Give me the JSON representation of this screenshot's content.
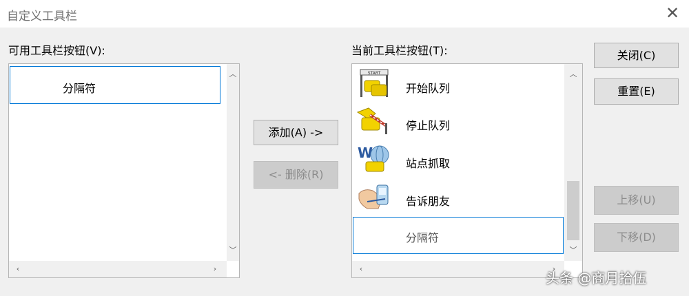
{
  "window": {
    "title": "自定义工具栏",
    "close_glyph": "✕"
  },
  "available": {
    "label": "可用工具栏按钮(V):",
    "items": [
      {
        "label": "分隔符",
        "selected": true
      }
    ]
  },
  "current": {
    "label": "当前工具栏按钮(T):",
    "items": [
      {
        "label": "开始队列",
        "icon": "start-queue-icon"
      },
      {
        "label": "停止队列",
        "icon": "stop-queue-icon"
      },
      {
        "label": "站点抓取",
        "icon": "site-grab-icon"
      },
      {
        "label": "告诉朋友",
        "icon": "tell-friend-icon"
      },
      {
        "label": "分隔符",
        "selected": true
      }
    ]
  },
  "buttons": {
    "add": "添加(A) ->",
    "remove": "<- 删除(R)",
    "close": "关闭(C)",
    "reset": "重置(E)",
    "move_up": "上移(U)",
    "move_down": "下移(D)"
  },
  "watermark": "头条 @商月拾伍"
}
